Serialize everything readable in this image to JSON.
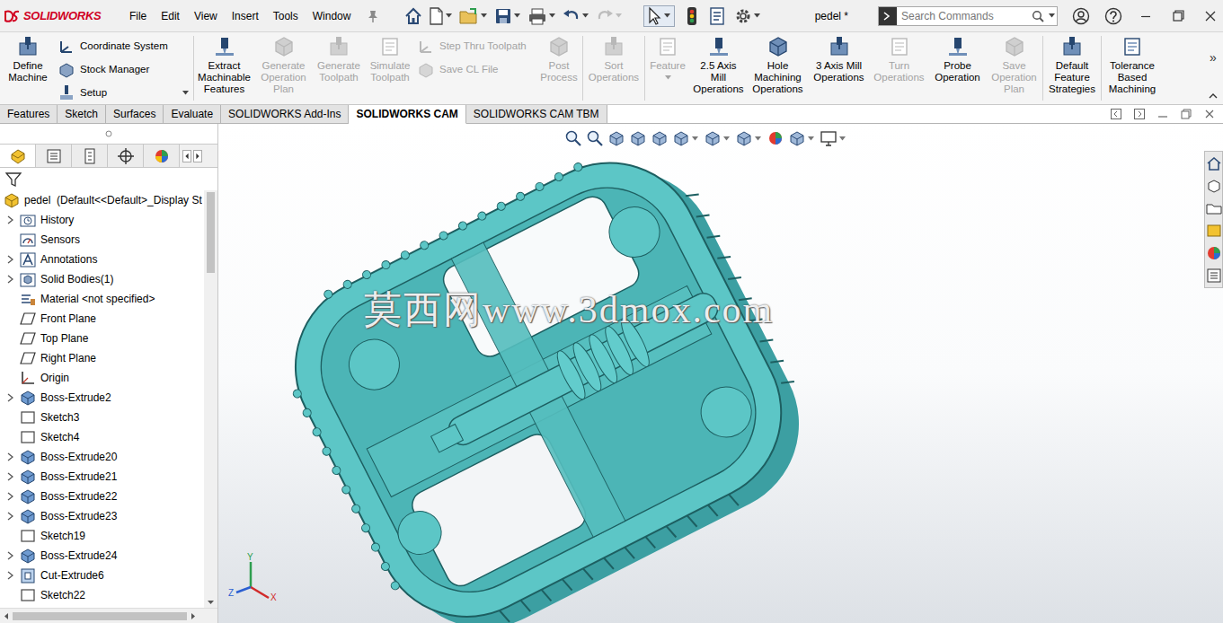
{
  "app": {
    "logo": "SOLIDWORKS",
    "document_title": "pedel *"
  },
  "menu": [
    "File",
    "Edit",
    "View",
    "Insert",
    "Tools",
    "Window"
  ],
  "search": {
    "placeholder": "Search Commands"
  },
  "ribbon": [
    {
      "kind": "large",
      "lines": [
        "Define",
        "Machine"
      ],
      "disabled": false,
      "dropdown": false
    },
    {
      "kind": "stack",
      "items": [
        {
          "label": "Coordinate System",
          "disabled": false,
          "dropdown": false
        },
        {
          "label": "Stock Manager",
          "disabled": false,
          "dropdown": false
        },
        {
          "label": "Setup",
          "disabled": false,
          "dropdown": true
        }
      ]
    },
    {
      "kind": "large",
      "lines": [
        "Extract",
        "Machinable",
        "Features"
      ],
      "disabled": false,
      "dropdown": false
    },
    {
      "kind": "large",
      "lines": [
        "Generate",
        "Operation",
        "Plan"
      ],
      "disabled": true,
      "dropdown": false
    },
    {
      "kind": "large",
      "lines": [
        "Generate",
        "Toolpath"
      ],
      "disabled": true,
      "dropdown": false
    },
    {
      "kind": "large",
      "lines": [
        "Simulate",
        "Toolpath"
      ],
      "disabled": true,
      "dropdown": false
    },
    {
      "kind": "stack",
      "items": [
        {
          "label": "Step Thru Toolpath",
          "disabled": true,
          "dropdown": false
        },
        {
          "label": "Save CL File",
          "disabled": true,
          "dropdown": false
        }
      ]
    },
    {
      "kind": "large",
      "lines": [
        "Post",
        "Process"
      ],
      "disabled": true,
      "dropdown": false
    },
    {
      "kind": "large",
      "lines": [
        "Sort",
        "Operations"
      ],
      "disabled": true,
      "dropdown": false
    },
    {
      "kind": "large",
      "lines": [
        "Feature"
      ],
      "disabled": true,
      "dropdown": true
    },
    {
      "kind": "large",
      "lines": [
        "2.5 Axis",
        "Mill",
        "Operations"
      ],
      "disabled": false,
      "dropdown": false
    },
    {
      "kind": "large",
      "lines": [
        "Hole",
        "Machining",
        "Operations"
      ],
      "disabled": false,
      "dropdown": false
    },
    {
      "kind": "large",
      "lines": [
        "3 Axis Mill",
        "Operations"
      ],
      "disabled": false,
      "dropdown": false
    },
    {
      "kind": "large",
      "lines": [
        "Turn",
        "Operations"
      ],
      "disabled": true,
      "dropdown": false
    },
    {
      "kind": "large",
      "lines": [
        "Probe",
        "Operation"
      ],
      "disabled": false,
      "dropdown": false
    },
    {
      "kind": "large",
      "lines": [
        "Save",
        "Operation",
        "Plan"
      ],
      "disabled": true,
      "dropdown": false
    },
    {
      "kind": "large",
      "lines": [
        "Default",
        "Feature",
        "Strategies"
      ],
      "disabled": false,
      "dropdown": false
    },
    {
      "kind": "large",
      "lines": [
        "Tolerance",
        "Based",
        "Machining"
      ],
      "disabled": false,
      "dropdown": false
    }
  ],
  "ribbon_more": "»",
  "tabs": [
    {
      "label": "Features",
      "selected": false
    },
    {
      "label": "Sketch",
      "selected": false
    },
    {
      "label": "Surfaces",
      "selected": false
    },
    {
      "label": "Evaluate",
      "selected": false
    },
    {
      "label": "SOLIDWORKS Add-Ins",
      "selected": false
    },
    {
      "label": "SOLIDWORKS CAM",
      "selected": true
    },
    {
      "label": "SOLIDWORKS CAM TBM",
      "selected": false
    }
  ],
  "panel_tabs": [
    {
      "selected": true
    },
    {
      "selected": false
    },
    {
      "selected": false
    },
    {
      "selected": false
    },
    {
      "selected": false
    }
  ],
  "tree": {
    "root": {
      "label": "pedel  (Default<<Default>_Display St"
    },
    "items": [
      {
        "label": "History",
        "kind": "history",
        "expandable": true
      },
      {
        "label": "Sensors",
        "kind": "sensor",
        "expandable": false
      },
      {
        "label": "Annotations",
        "kind": "annotation",
        "expandable": true
      },
      {
        "label": "Solid Bodies(1)",
        "kind": "bodies",
        "expandable": true
      },
      {
        "label": "Material <not specified>",
        "kind": "material",
        "expandable": false
      },
      {
        "label": "Front Plane",
        "kind": "plane",
        "expandable": false
      },
      {
        "label": "Top Plane",
        "kind": "plane",
        "expandable": false
      },
      {
        "label": "Right Plane",
        "kind": "plane",
        "expandable": false
      },
      {
        "label": "Origin",
        "kind": "origin",
        "expandable": false
      },
      {
        "label": "Boss-Extrude2",
        "kind": "feature",
        "expandable": true
      },
      {
        "label": "Sketch3",
        "kind": "sketch",
        "expandable": false
      },
      {
        "label": "Sketch4",
        "kind": "sketch",
        "expandable": false
      },
      {
        "label": "Boss-Extrude20",
        "kind": "feature",
        "expandable": true
      },
      {
        "label": "Boss-Extrude21",
        "kind": "feature",
        "expandable": true
      },
      {
        "label": "Boss-Extrude22",
        "kind": "feature",
        "expandable": true
      },
      {
        "label": "Boss-Extrude23",
        "kind": "feature",
        "expandable": true
      },
      {
        "label": "Sketch19",
        "kind": "sketch",
        "expandable": false
      },
      {
        "label": "Boss-Extrude24",
        "kind": "feature",
        "expandable": true
      },
      {
        "label": "Cut-Extrude6",
        "kind": "cut",
        "expandable": true
      },
      {
        "label": "Sketch22",
        "kind": "sketch",
        "expandable": false
      }
    ]
  },
  "watermark": "莫西网www.3dmox.com",
  "triad": {
    "x": "X",
    "y": "Y",
    "z": "Z"
  }
}
